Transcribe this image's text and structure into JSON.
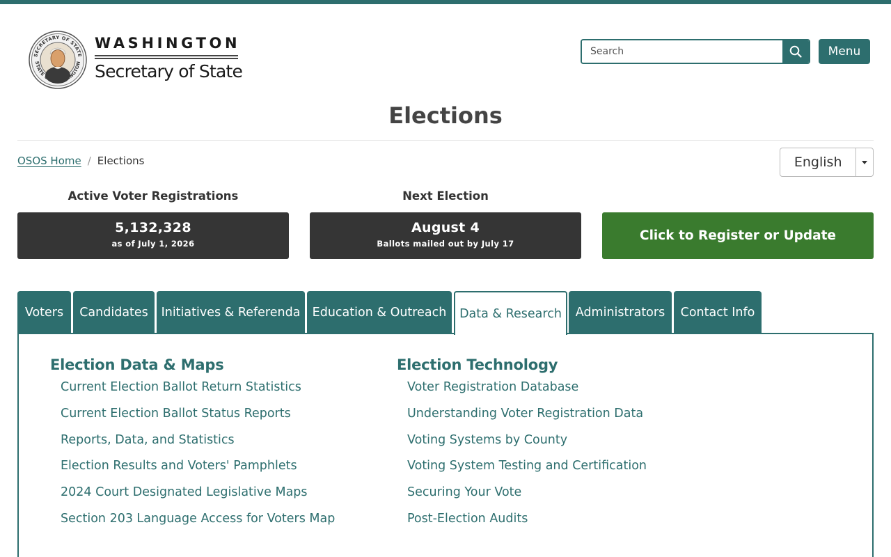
{
  "logo": {
    "wordmark": "WASHINGTON",
    "subtitle": "Secretary of State",
    "seal_top_text": "SECRETARY OF STATE",
    "seal_bottom_text": "STATE OF WASHINGTON"
  },
  "search": {
    "placeholder": "Search",
    "button_icon": "search-icon"
  },
  "menu": {
    "label": "Menu"
  },
  "page": {
    "title": "Elections"
  },
  "breadcrumb": {
    "home": "OSOS Home",
    "separator": "/",
    "current": "Elections"
  },
  "language": {
    "selected": "English"
  },
  "stats": {
    "registrations": {
      "label": "Active Voter Registrations",
      "value": "5,132,328",
      "sub": "as of July 1, 2026"
    },
    "next_election": {
      "label": "Next Election",
      "value": "August 4",
      "sub": "Ballots mailed out by July 17"
    }
  },
  "register": {
    "label": "Click to Register or Update"
  },
  "tabs": [
    {
      "label": "Voters"
    },
    {
      "label": "Candidates"
    },
    {
      "label": "Initiatives & Referenda"
    },
    {
      "label": "Education & Outreach"
    },
    {
      "label": "Data & Research",
      "active": true
    },
    {
      "label": "Administrators"
    },
    {
      "label": "Contact Info"
    }
  ],
  "panel": {
    "left": {
      "heading": "Election Data & Maps",
      "links": [
        "Current Election Ballot Return Statistics",
        "Current Election Ballot Status Reports",
        "Reports, Data, and Statistics",
        "Election Results and Voters' Pamphlets",
        "2024 Court Designated Legislative Maps",
        "Section 203 Language Access for Voters Map"
      ]
    },
    "right": {
      "heading": "Election Technology",
      "links": [
        "Voter Registration Database",
        "Understanding Voter Registration Data",
        "Voting Systems by County",
        "Voting System Testing and Certification",
        "Securing Your Vote",
        "Post-Election Audits"
      ]
    }
  },
  "colors": {
    "brand_teal": "#2d6e6e",
    "stat_card": "#353535",
    "register_green": "#3a7b2e"
  }
}
